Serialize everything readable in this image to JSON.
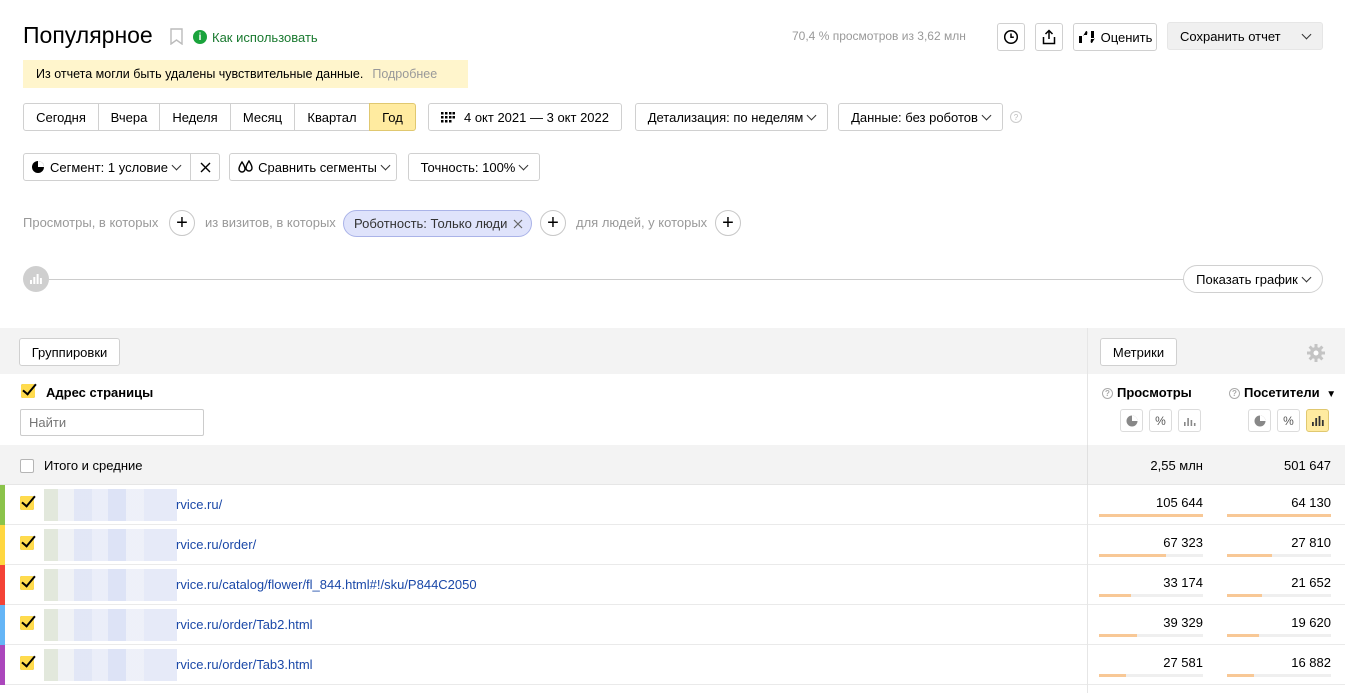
{
  "header": {
    "title": "Популярное",
    "help_link": "Как использовать",
    "views_summary": "70,4 % просмотров из 3,62 млн",
    "rate_label": "Оценить",
    "save_report_label": "Сохранить отчет"
  },
  "notice": {
    "text": "Из отчета могли быть удалены чувствительные данные.",
    "more_link": "Подробнее"
  },
  "periods": {
    "items": [
      "Сегодня",
      "Вчера",
      "Неделя",
      "Месяц",
      "Квартал",
      "Год"
    ],
    "active": "Год",
    "date_range": "4 окт 2021 — 3 окт 2022",
    "detail_label": "Детализация: по неделям",
    "data_label": "Данные: без роботов"
  },
  "segment": {
    "segment_label": "Сегмент: 1 условие",
    "compare_label": "Сравнить сегменты",
    "accuracy_label": "Точность: 100%"
  },
  "conditions": {
    "views_label": "Просмотры, в которых",
    "visits_label": "из визитов, в которых",
    "chip_label": "Роботность: Только люди",
    "people_label": "для людей, у которых"
  },
  "chart_toggle": {
    "label": "Показать график"
  },
  "table": {
    "groupings_label": "Группировки",
    "metrics_label": "Метрики",
    "dimension_header": "Адрес страницы",
    "search_placeholder": "Найти",
    "col_views": "Просмотры",
    "col_visitors": "Посетители",
    "sort_indicator": "▼",
    "totals_label": "Итого и средние",
    "totals_views": "2,55 млн",
    "totals_visitors": "501 647",
    "rows": [
      {
        "url": "rvice.ru/",
        "views": "105 644",
        "visitors": "64 130",
        "color": "#8bc34a",
        "views_share": 1.0,
        "visitors_share": 1.0
      },
      {
        "url": "rvice.ru/order/",
        "views": "67 323",
        "visitors": "27 810",
        "color": "#ffd740",
        "views_share": 0.64,
        "visitors_share": 0.43
      },
      {
        "url": "rvice.ru/catalog/flower/fl_844.html#!/sku/P844C2050",
        "views": "33 174",
        "visitors": "21 652",
        "color": "#f44336",
        "views_share": 0.31,
        "visitors_share": 0.34
      },
      {
        "url": "rvice.ru/order/Tab2.html",
        "views": "39 329",
        "visitors": "19 620",
        "color": "#64b5f6",
        "views_share": 0.37,
        "visitors_share": 0.31
      },
      {
        "url": "rvice.ru/order/Tab3.html",
        "views": "27 581",
        "visitors": "16 882",
        "color": "#ab47bc",
        "views_share": 0.26,
        "visitors_share": 0.26
      }
    ]
  }
}
